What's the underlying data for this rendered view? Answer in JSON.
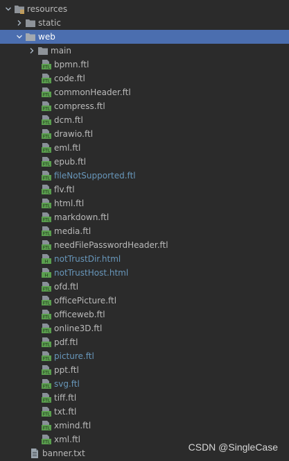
{
  "colors": {
    "background": "#2b2b2b",
    "selection": "#4b6eaf",
    "text": "#bbbbbb",
    "modified_text": "#6897bb",
    "ftl_icon": "#62a45a",
    "folder_icon": "#8e9399"
  },
  "tree": {
    "resources": {
      "label": "resources",
      "icon": "resources-folder-icon",
      "expanded": true
    },
    "static": {
      "label": "static",
      "icon": "folder-icon",
      "expanded": false
    },
    "web": {
      "label": "web",
      "icon": "folder-icon",
      "expanded": true,
      "selected": true
    },
    "main": {
      "label": "main",
      "icon": "folder-icon",
      "expanded": false
    },
    "files": [
      {
        "label": "bpmn.ftl",
        "type": "ftl",
        "modified": false
      },
      {
        "label": "code.ftl",
        "type": "ftl",
        "modified": false
      },
      {
        "label": "commonHeader.ftl",
        "type": "ftl",
        "modified": false
      },
      {
        "label": "compress.ftl",
        "type": "ftl",
        "modified": false
      },
      {
        "label": "dcm.ftl",
        "type": "ftl",
        "modified": false
      },
      {
        "label": "drawio.ftl",
        "type": "ftl",
        "modified": false
      },
      {
        "label": "eml.ftl",
        "type": "ftl",
        "modified": false
      },
      {
        "label": "epub.ftl",
        "type": "ftl",
        "modified": false
      },
      {
        "label": "fileNotSupported.ftl",
        "type": "ftl",
        "modified": true
      },
      {
        "label": "flv.ftl",
        "type": "ftl",
        "modified": false
      },
      {
        "label": "html.ftl",
        "type": "ftl",
        "modified": false
      },
      {
        "label": "markdown.ftl",
        "type": "ftl",
        "modified": false
      },
      {
        "label": "media.ftl",
        "type": "ftl",
        "modified": false
      },
      {
        "label": "needFilePasswordHeader.ftl",
        "type": "ftl",
        "modified": false
      },
      {
        "label": "notTrustDir.html",
        "type": "html",
        "modified": true
      },
      {
        "label": "notTrustHost.html",
        "type": "html",
        "modified": true
      },
      {
        "label": "ofd.ftl",
        "type": "ftl",
        "modified": false
      },
      {
        "label": "officePicture.ftl",
        "type": "ftl",
        "modified": false
      },
      {
        "label": "officeweb.ftl",
        "type": "ftl",
        "modified": false
      },
      {
        "label": "online3D.ftl",
        "type": "ftl",
        "modified": false
      },
      {
        "label": "pdf.ftl",
        "type": "ftl",
        "modified": false
      },
      {
        "label": "picture.ftl",
        "type": "ftl",
        "modified": true
      },
      {
        "label": "ppt.ftl",
        "type": "ftl",
        "modified": false
      },
      {
        "label": "svg.ftl",
        "type": "ftl",
        "modified": true
      },
      {
        "label": "tiff.ftl",
        "type": "ftl",
        "modified": false
      },
      {
        "label": "txt.ftl",
        "type": "ftl",
        "modified": false
      },
      {
        "label": "xmind.ftl",
        "type": "ftl",
        "modified": false
      },
      {
        "label": "xml.ftl",
        "type": "ftl",
        "modified": false
      }
    ],
    "banner": {
      "label": "banner.txt",
      "icon": "text-file-icon"
    }
  },
  "watermark": "CSDN @SingleCase"
}
